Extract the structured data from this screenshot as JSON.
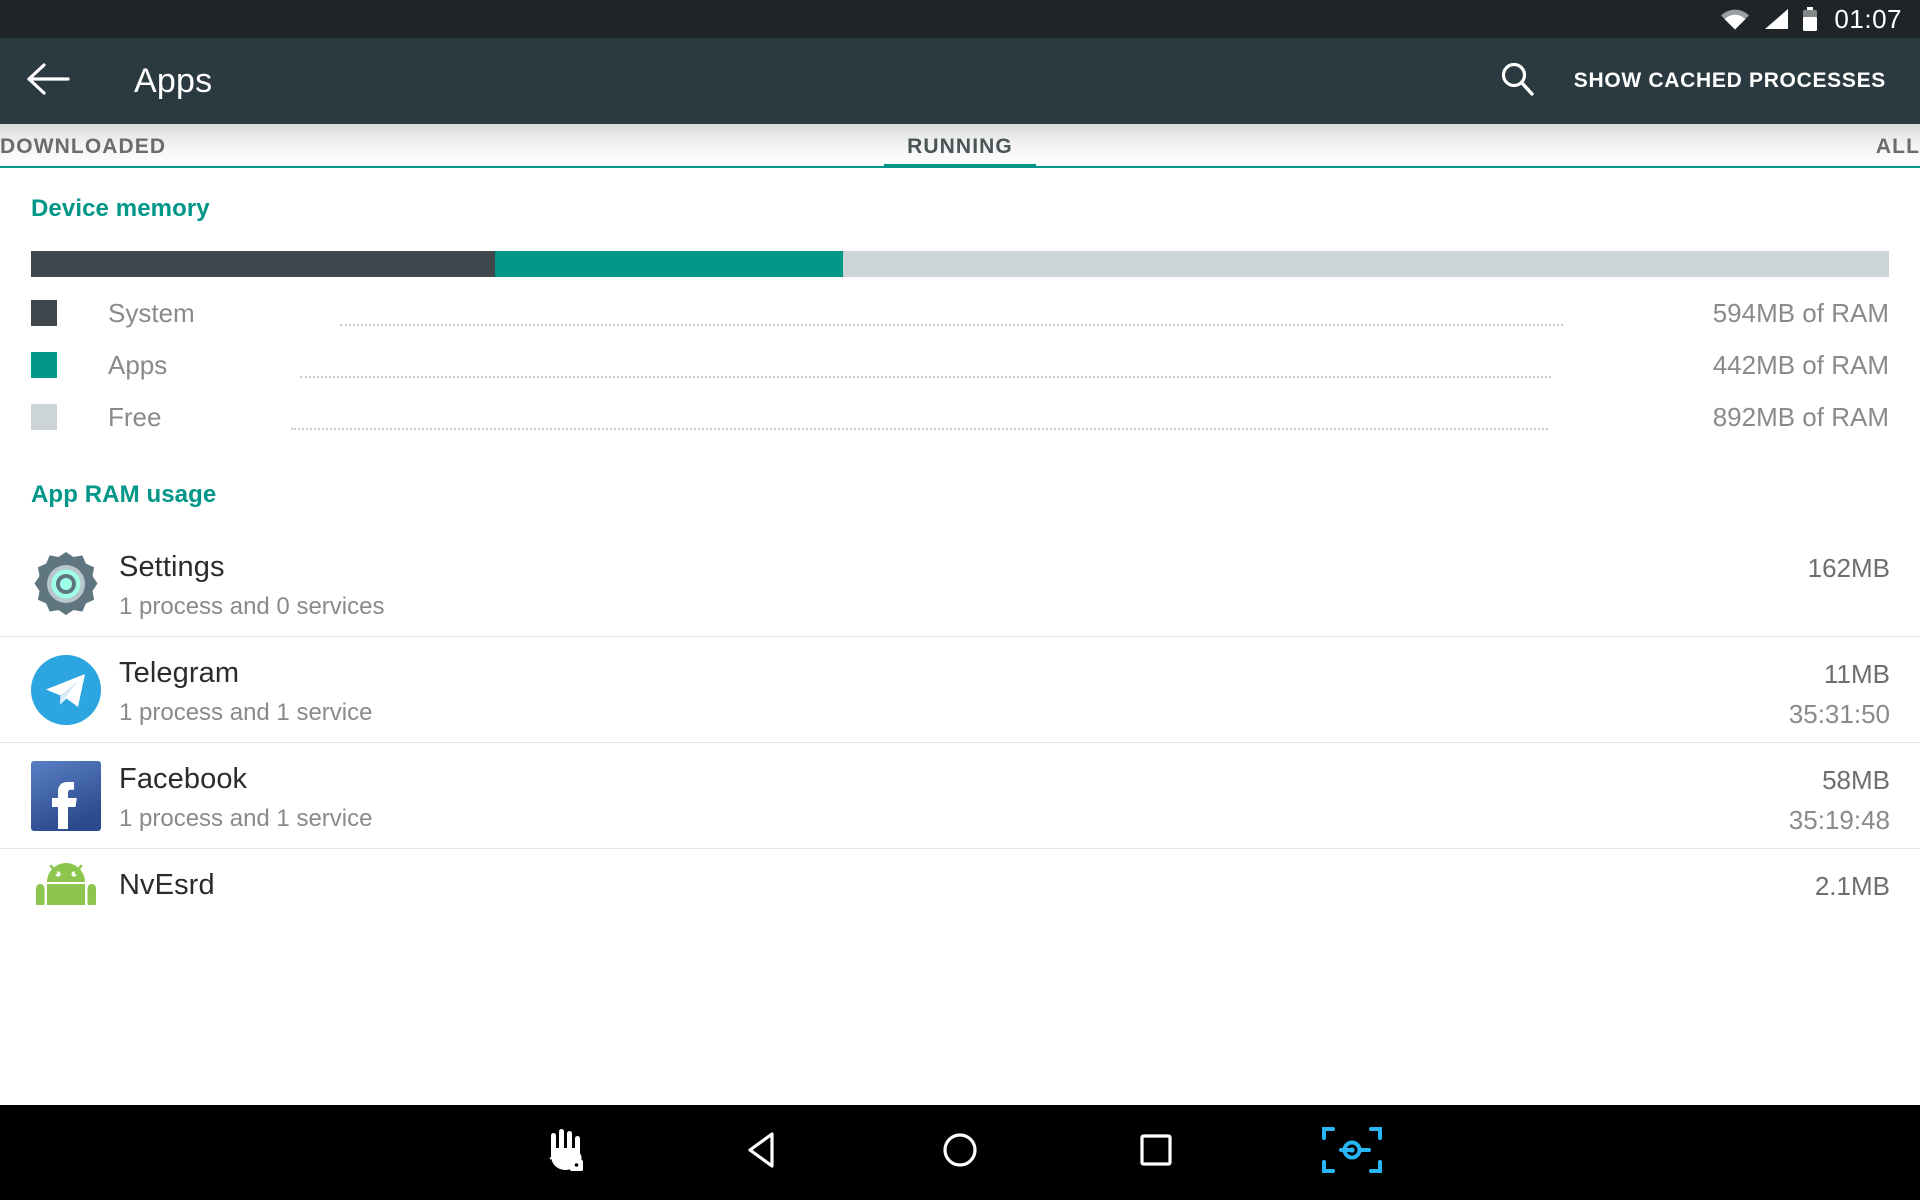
{
  "status_bar": {
    "clock": "01:07",
    "icons": [
      "wifi-icon",
      "signal-icon",
      "battery-icon"
    ]
  },
  "action_bar": {
    "back_icon": "arrow-back-icon",
    "title": "Apps",
    "search_icon": "search-icon",
    "cached_label": "SHOW CACHED PROCESSES"
  },
  "tabs": [
    {
      "label": "DOWNLOADED",
      "active": false
    },
    {
      "label": "RUNNING",
      "active": true
    },
    {
      "label": "ALL",
      "active": false
    }
  ],
  "device_memory": {
    "heading": "Device memory",
    "legend": [
      {
        "label": "System",
        "value": "594MB of RAM",
        "color": "#3f474d"
      },
      {
        "label": "Apps",
        "value": "442MB of RAM",
        "color": "#009688"
      },
      {
        "label": "Free",
        "value": "892MB of RAM",
        "color": "#ccd4d7"
      }
    ]
  },
  "app_ram_usage": {
    "heading": "App RAM usage",
    "items": [
      {
        "name": "Settings",
        "subtitle": "1 process and 0 services",
        "memory": "162MB",
        "time": "",
        "icon": "settings-gear-icon"
      },
      {
        "name": "Telegram",
        "subtitle": "1 process and 1 service",
        "memory": "11MB",
        "time": "35:31:50",
        "icon": "telegram-icon"
      },
      {
        "name": "Facebook",
        "subtitle": "1 process and 1 service",
        "memory": "58MB",
        "time": "35:19:48",
        "icon": "facebook-icon"
      },
      {
        "name": "NvEsrd",
        "subtitle": "",
        "memory": "2.1MB",
        "time": "",
        "icon": "android-robot-icon"
      }
    ]
  },
  "nav_bar": {
    "buttons": [
      "accessibility-hand-icon",
      "back-triangle-icon",
      "home-circle-icon",
      "recents-square-icon",
      "screenshot-capture-icon"
    ]
  },
  "chart_data": {
    "type": "bar",
    "title": "Device memory",
    "categories": [
      "System",
      "Apps",
      "Free"
    ],
    "values": [
      594,
      442,
      892
    ],
    "unit": "MB",
    "total": 1928,
    "colors": [
      "#3f474d",
      "#009688",
      "#ccd4d7"
    ],
    "orientation": "horizontal-stacked"
  },
  "colors": {
    "accent_teal": "#009688",
    "action_bar": "#2b3a41",
    "status_bar": "#1f2527",
    "nav_bar": "#000000",
    "capture_blue": "#29b6f6"
  }
}
